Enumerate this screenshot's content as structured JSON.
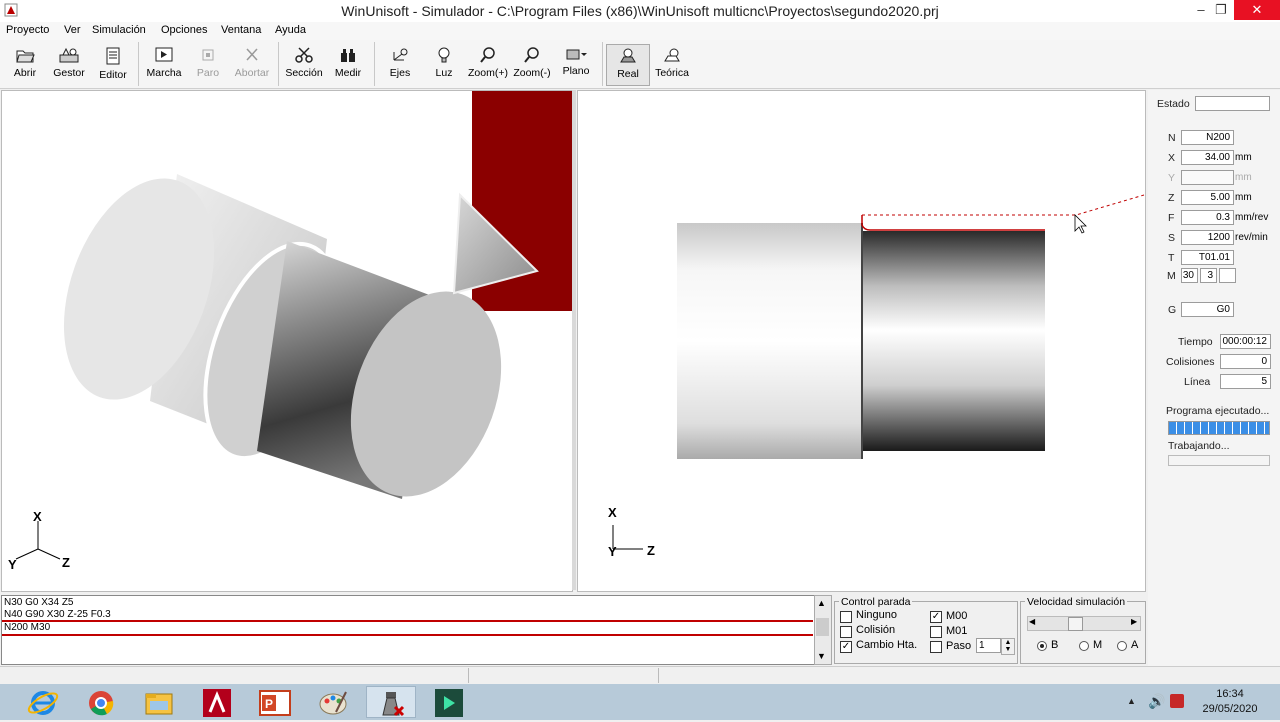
{
  "window": {
    "title": "WinUnisoft - Simulador - C:\\Program Files (x86)\\WinUnisoft multicnc\\Proyectos\\segundo2020.prj",
    "controls": {
      "minimize": "–",
      "maximize": "❐",
      "close": "✕"
    }
  },
  "menu": [
    "Proyecto",
    "Ver",
    "Simulación",
    "Opciones",
    "Ventana",
    "Ayuda"
  ],
  "toolbar": {
    "abrir": "Abrir",
    "gestor": "Gestor",
    "editor": "Editor",
    "marcha": "Marcha",
    "paro": "Paro",
    "abortar": "Abortar",
    "seccion": "Sección",
    "medir": "Medir",
    "ejes": "Ejes",
    "luz": "Luz",
    "zoom_in": "Zoom(+)",
    "zoom_out": "Zoom(-)",
    "plano": "Plano",
    "real": "Real",
    "teorica": "Teórica"
  },
  "axes": {
    "x": "X",
    "y": "Y",
    "z": "Z"
  },
  "status_panel": {
    "estado_label": "Estado",
    "estado_value": "",
    "n_label": "N",
    "n_value": "N200",
    "x_label": "X",
    "x_value": "34.00",
    "x_unit": "mm",
    "y_label": "Y",
    "y_value": "",
    "y_unit": "mm",
    "z_label": "Z",
    "z_value": "5.00",
    "z_unit": "mm",
    "f_label": "F",
    "f_value": "0.3",
    "f_unit": "mm/rev",
    "s_label": "S",
    "s_value": "1200",
    "s_unit": "rev/min",
    "t_label": "T",
    "t_value": "T01.01",
    "m_label": "M",
    "m_value1": "30",
    "m_value2": "3",
    "m_value3": "",
    "g_label": "G",
    "g_value": "G0",
    "tiempo_label": "Tiempo",
    "tiempo_value": "000:00:12",
    "colisiones_label": "Colisiones",
    "colisiones_value": "0",
    "linea_label": "Línea",
    "linea_value": "5",
    "programa_label": "Programa ejecutado...",
    "programa_progress": 1.0,
    "trabajando_label": "Trabajando...",
    "trabajando_progress": 0.0
  },
  "program_lines": [
    "N30 G0 X34 Z5",
    "N40 G90 X30 Z-25 F0.3",
    "N200 M30"
  ],
  "control_parada": {
    "title": "Control parada",
    "ninguno": "Ninguno",
    "ninguno_checked": false,
    "colision": "Colisión",
    "colision_checked": false,
    "cambio": "Cambio Hta.",
    "cambio_checked": true,
    "m00": "M00",
    "m00_checked": true,
    "m01": "M01",
    "m01_checked": false,
    "paso": "Paso",
    "paso_checked": false,
    "paso_value": "1"
  },
  "velocidad": {
    "title": "Velocidad simulación",
    "b": "B",
    "m": "M",
    "a": "A",
    "selected": "B"
  },
  "taskbar": {
    "time": "16:34",
    "date": "29/05/2020",
    "apps": [
      "internet-explorer",
      "chrome",
      "file-explorer",
      "autocad",
      "powerpoint",
      "paint",
      "winunisoft",
      "filmora"
    ]
  },
  "colors": {
    "tool_holder": "#8b0000",
    "progress": "#3a8ee6",
    "path": "#c00000"
  }
}
